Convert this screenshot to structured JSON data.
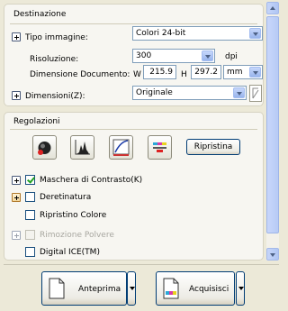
{
  "destinazione": {
    "title": "Destinazione",
    "tipo_immagine": {
      "label": "Tipo immagine:",
      "value": "Colori 24-bit"
    },
    "risoluzione": {
      "label": "Risoluzione:",
      "value": "300",
      "unit": "dpi"
    },
    "dimensione_documento": {
      "label": "Dimensione Documento:",
      "w_label": "W",
      "w_value": "215.9",
      "h_label": "H",
      "h_value": "297.2",
      "unit": "mm"
    },
    "dimensioni": {
      "label": "Dimensioni(Z):",
      "value": "Originale"
    }
  },
  "regolazioni": {
    "title": "Regolazioni",
    "reset_label": "Ripristina",
    "options": [
      {
        "label": "Maschera di Contrasto(K)",
        "checked": true,
        "expandable": true,
        "enabled": true
      },
      {
        "label": "Deretinatura",
        "checked": false,
        "expandable": true,
        "enabled": true
      },
      {
        "label": "Ripristino Colore",
        "checked": false,
        "expandable": false,
        "enabled": true
      },
      {
        "label": "Rimozione Polvere",
        "checked": false,
        "expandable": true,
        "enabled": false
      },
      {
        "label": "Digital ICE(TM)",
        "checked": false,
        "expandable": false,
        "enabled": true
      }
    ]
  },
  "actions": {
    "preview_label": "Anteprima",
    "scan_label": "Acquisisci"
  },
  "icons": [
    "expand-icon",
    "auto-exposure-icon",
    "histogram-icon",
    "tone-curve-icon",
    "color-palette-icon",
    "lock-ratio-icon",
    "preview-page-icon",
    "scan-page-icon",
    "dropdown-arrow-icon"
  ],
  "colors": {
    "window_bg": "#ece9d8",
    "panel_bg": "#f7f6f1",
    "checkbox_check": "#21a121",
    "field_border": "#7f9db9"
  }
}
